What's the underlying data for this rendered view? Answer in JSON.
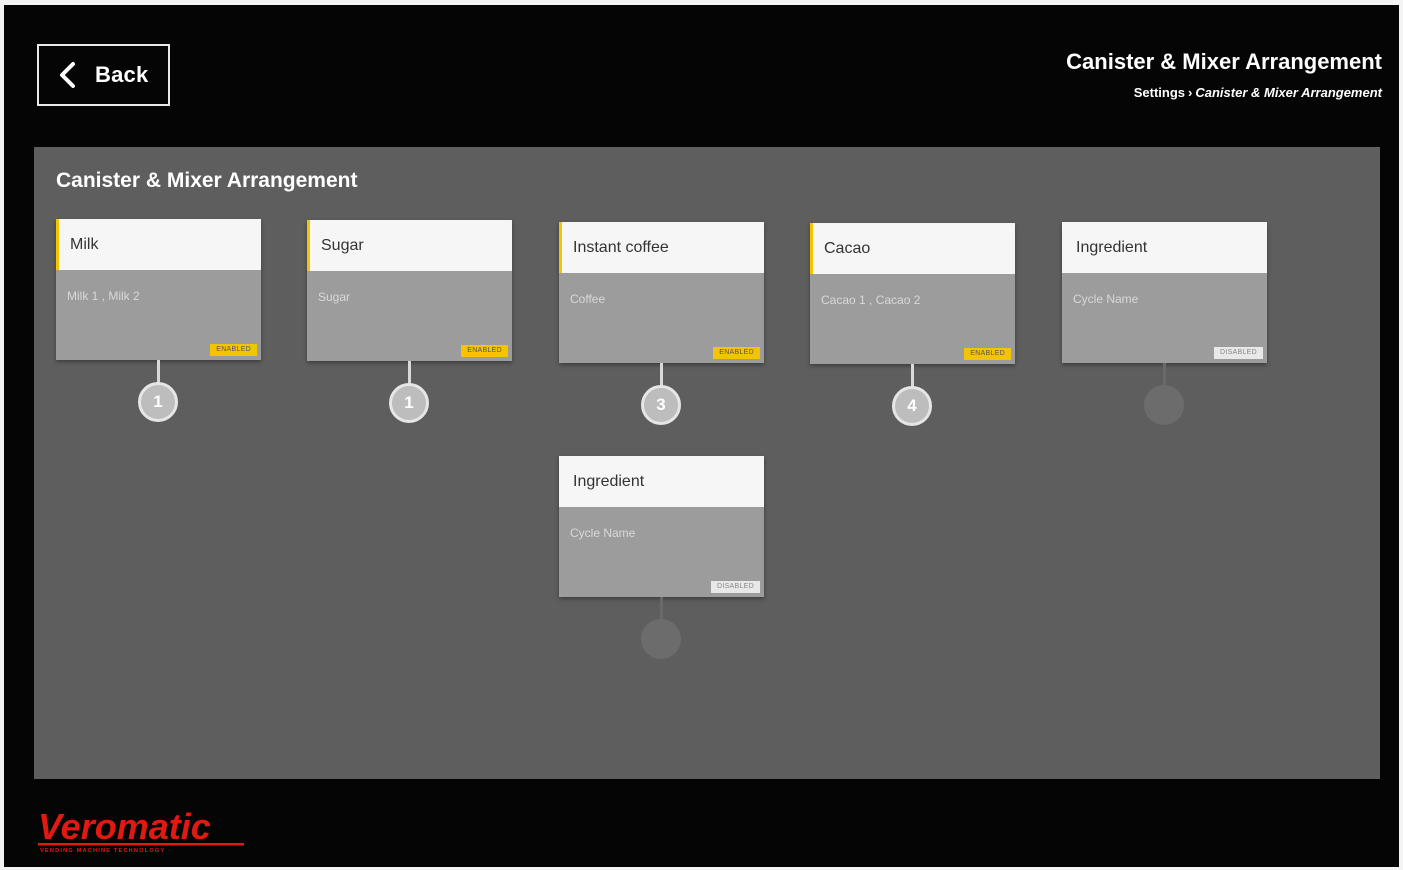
{
  "header": {
    "back_label": "Back",
    "title": "Canister & Mixer Arrangement",
    "breadcrumb": {
      "root": "Settings",
      "separator": "›",
      "current": "Canister & Mixer Arrangement"
    }
  },
  "panel": {
    "title": "Canister & Mixer Arrangement",
    "cards": [
      {
        "name": "Milk",
        "sub": "Milk 1 , Milk 2",
        "status": "ENABLED",
        "slot": "1",
        "enabled": true
      },
      {
        "name": "Sugar",
        "sub": "Sugar",
        "status": "ENABLED",
        "slot": "1",
        "enabled": true
      },
      {
        "name": "Instant coffee",
        "sub": "Coffee",
        "status": "ENABLED",
        "slot": "3",
        "enabled": true
      },
      {
        "name": "Cacao",
        "sub": "Cacao 1 , Cacao 2",
        "status": "ENABLED",
        "slot": "4",
        "enabled": true
      },
      {
        "name": "Ingredient",
        "sub": "Cycle Name",
        "status": "DISABLED",
        "slot": "",
        "enabled": false
      },
      {
        "name": "Ingredient",
        "sub": "Cycle Name",
        "status": "DISABLED",
        "slot": "",
        "enabled": false
      }
    ]
  },
  "brand": {
    "logo_text": "Veromatic",
    "tagline": "VENDING MACHINE TECHNOLOGY",
    "color": "#e01a12"
  },
  "colors": {
    "accent": "#f2c500",
    "panel": "#5e5e5e",
    "background": "#050505"
  }
}
